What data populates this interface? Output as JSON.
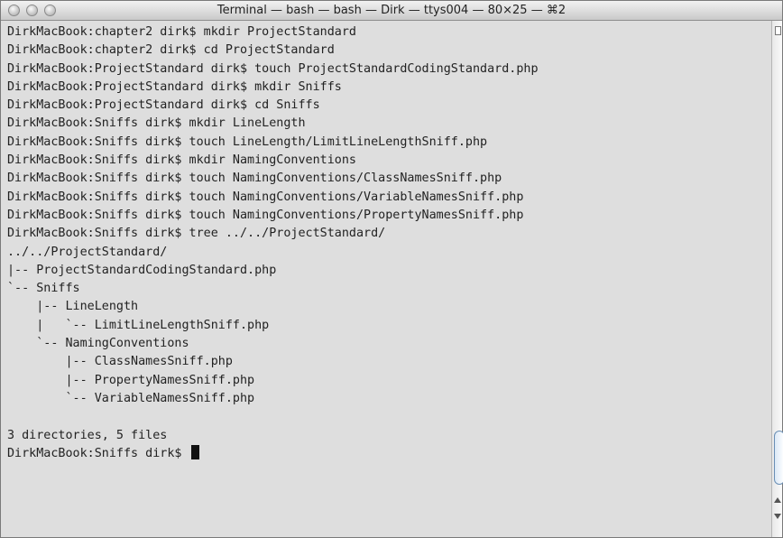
{
  "window": {
    "title": "Terminal — bash — bash — Dirk — ttys004 — 80×25 — ⌘2"
  },
  "terminal": {
    "lines": [
      "DirkMacBook:chapter2 dirk$ mkdir ProjectStandard",
      "DirkMacBook:chapter2 dirk$ cd ProjectStandard",
      "DirkMacBook:ProjectStandard dirk$ touch ProjectStandardCodingStandard.php",
      "DirkMacBook:ProjectStandard dirk$ mkdir Sniffs",
      "DirkMacBook:ProjectStandard dirk$ cd Sniffs",
      "DirkMacBook:Sniffs dirk$ mkdir LineLength",
      "DirkMacBook:Sniffs dirk$ touch LineLength/LimitLineLengthSniff.php",
      "DirkMacBook:Sniffs dirk$ mkdir NamingConventions",
      "DirkMacBook:Sniffs dirk$ touch NamingConventions/ClassNamesSniff.php",
      "DirkMacBook:Sniffs dirk$ touch NamingConventions/VariableNamesSniff.php",
      "DirkMacBook:Sniffs dirk$ touch NamingConventions/PropertyNamesSniff.php",
      "DirkMacBook:Sniffs dirk$ tree ../../ProjectStandard/",
      "../../ProjectStandard/",
      "|-- ProjectStandardCodingStandard.php",
      "`-- Sniffs",
      "    |-- LineLength",
      "    |   `-- LimitLineLengthSniff.php",
      "    `-- NamingConventions",
      "        |-- ClassNamesSniff.php",
      "        |-- PropertyNamesSniff.php",
      "        `-- VariableNamesSniff.php",
      "",
      "3 directories, 5 files"
    ],
    "prompt": "DirkMacBook:Sniffs dirk$ "
  },
  "icons": {
    "close": "close-window-icon",
    "minimize": "minimize-window-icon",
    "zoom": "zoom-window-icon"
  }
}
